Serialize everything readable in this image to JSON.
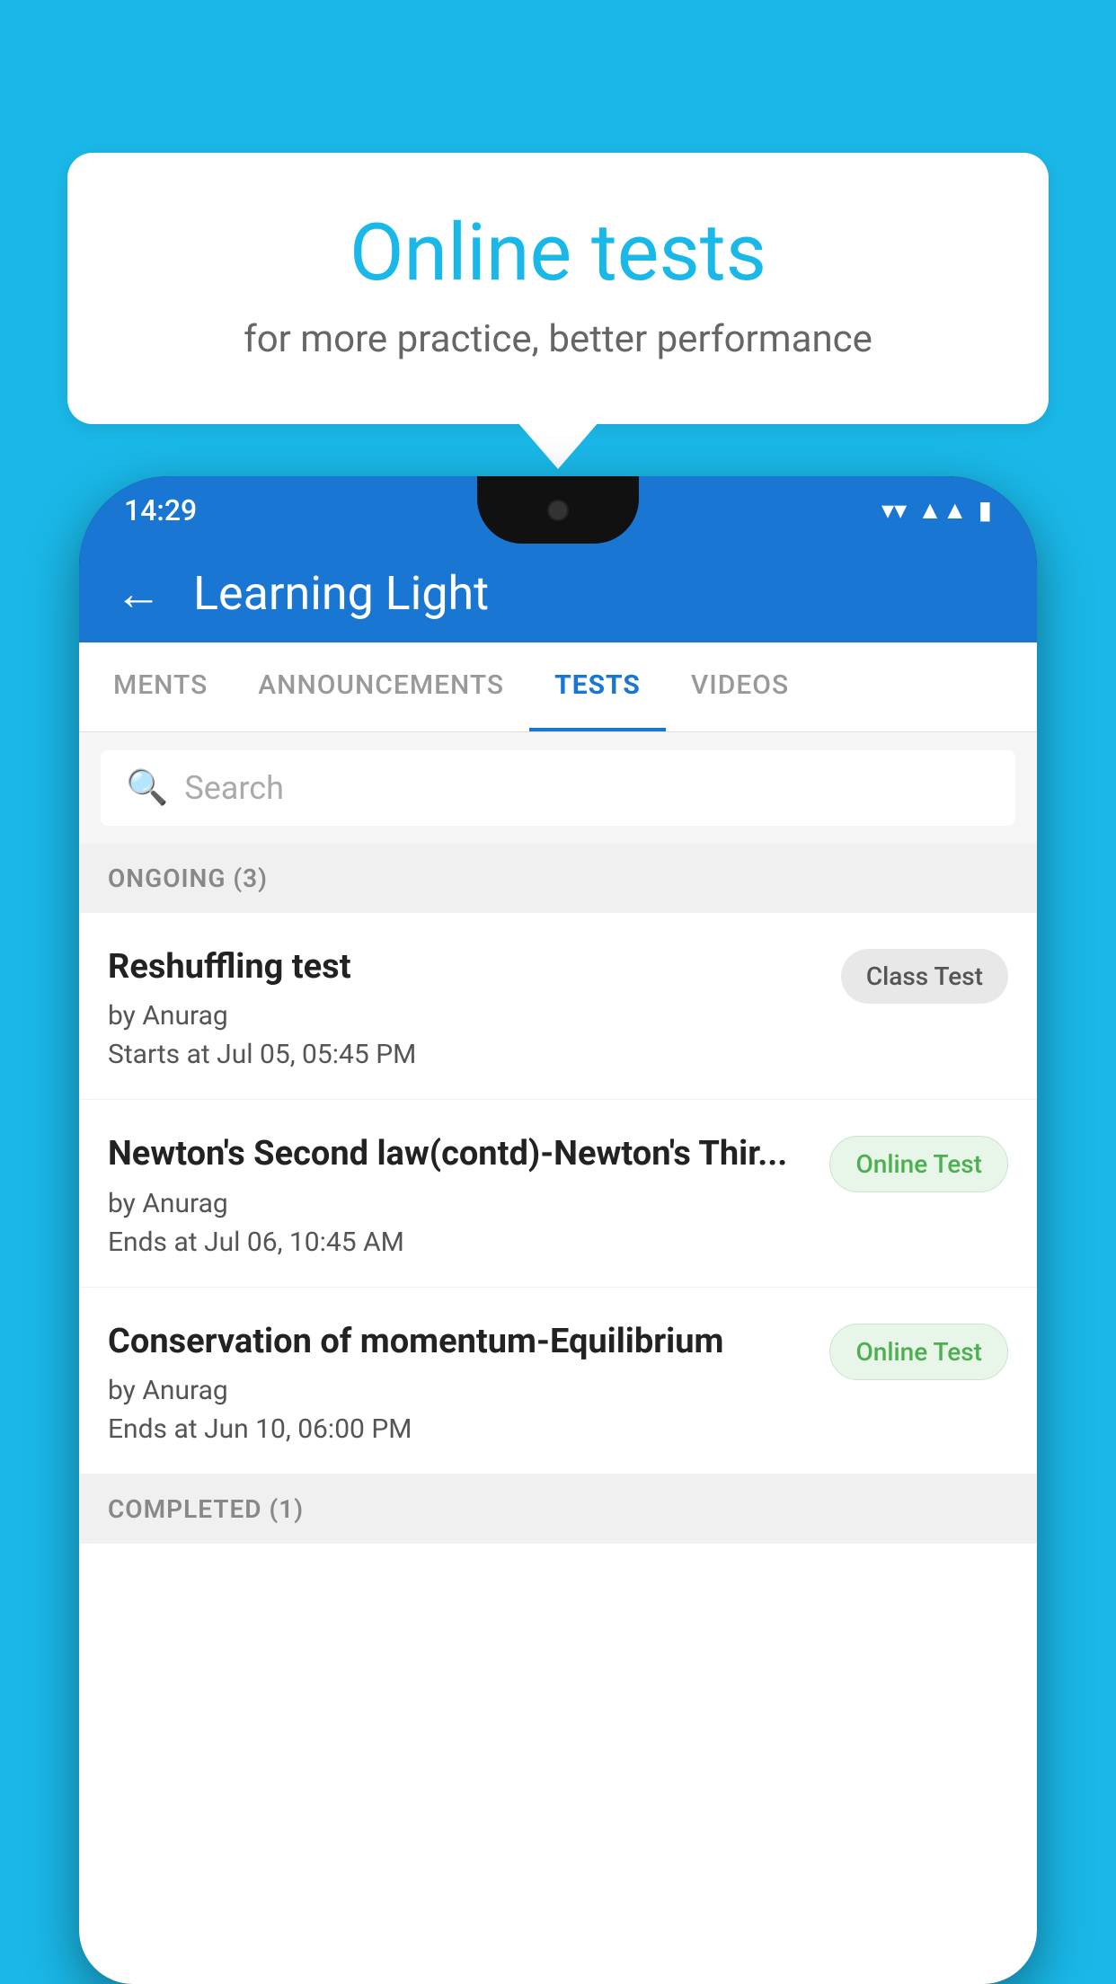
{
  "background": {
    "color": "#1ab8e8"
  },
  "bubble": {
    "title": "Online tests",
    "subtitle": "for more practice, better performance"
  },
  "phone": {
    "statusBar": {
      "time": "14:29",
      "icons": [
        "wifi",
        "signal",
        "battery"
      ]
    },
    "appBar": {
      "title": "Learning Light",
      "backLabel": "←"
    },
    "tabs": [
      {
        "label": "MENTS",
        "active": false
      },
      {
        "label": "ANNOUNCEMENTS",
        "active": false
      },
      {
        "label": "TESTS",
        "active": true
      },
      {
        "label": "VIDEOS",
        "active": false
      }
    ],
    "search": {
      "placeholder": "Search"
    },
    "sections": [
      {
        "header": "ONGOING (3)",
        "items": [
          {
            "title": "Reshuffling test",
            "author": "by Anurag",
            "time": "Starts at  Jul 05, 05:45 PM",
            "badge": "Class Test",
            "badgeType": "class"
          },
          {
            "title": "Newton's Second law(contd)-Newton's Thir...",
            "author": "by Anurag",
            "time": "Ends at  Jul 06, 10:45 AM",
            "badge": "Online Test",
            "badgeType": "online"
          },
          {
            "title": "Conservation of momentum-Equilibrium",
            "author": "by Anurag",
            "time": "Ends at  Jun 10, 06:00 PM",
            "badge": "Online Test",
            "badgeType": "online"
          }
        ]
      },
      {
        "header": "COMPLETED (1)",
        "items": []
      }
    ]
  }
}
